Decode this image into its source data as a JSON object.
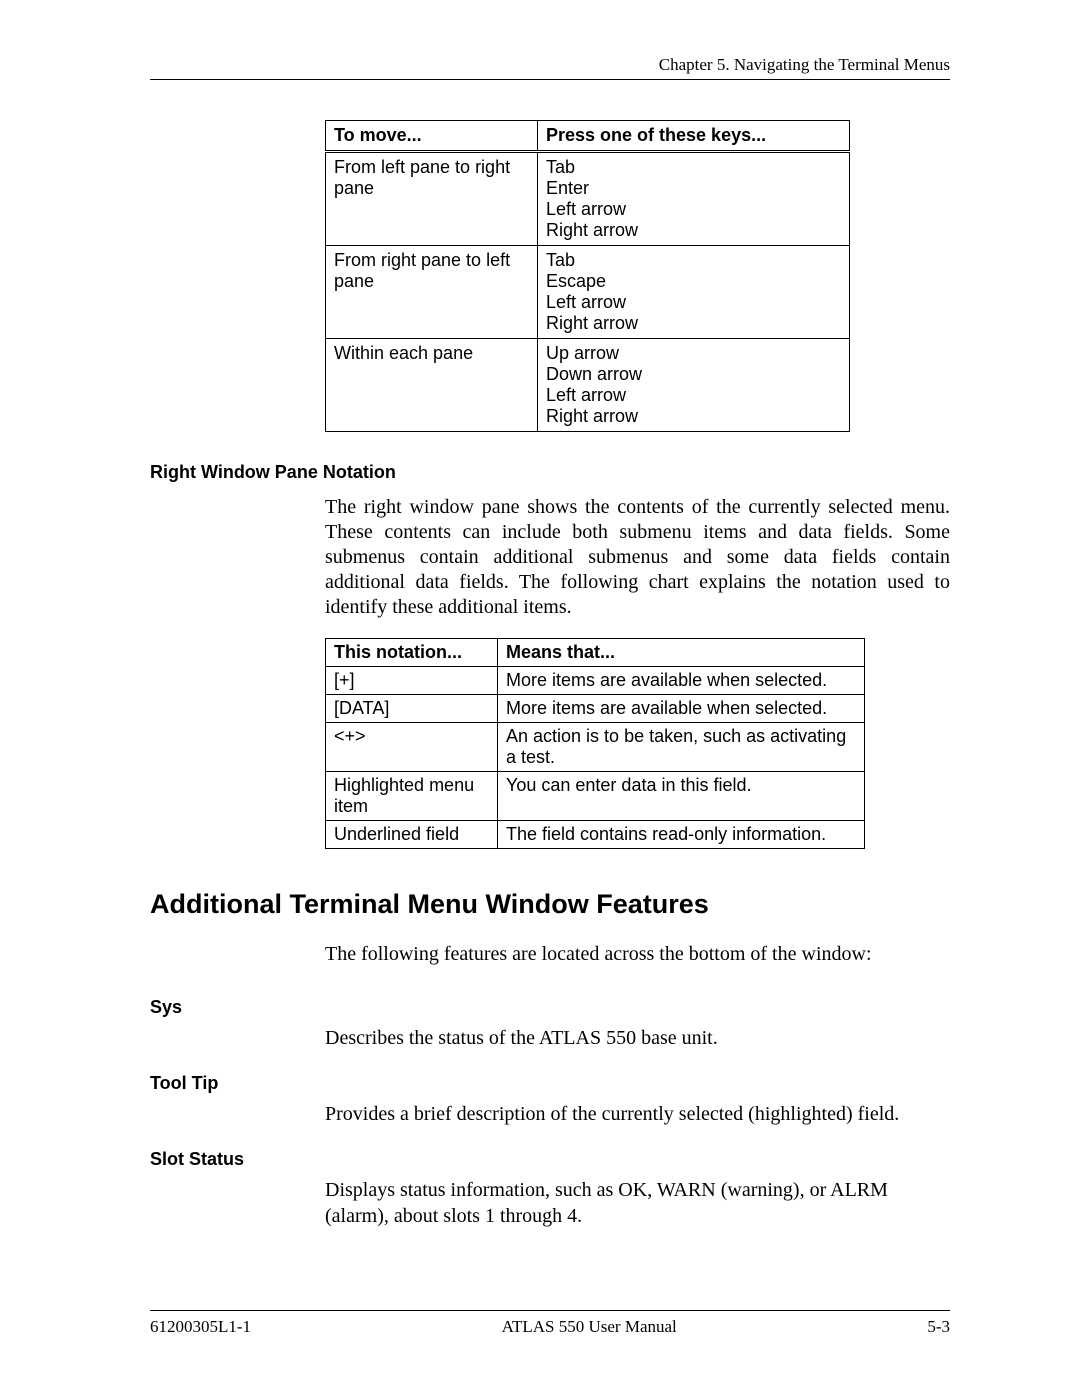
{
  "header": {
    "chapter": "Chapter 5.  Navigating the Terminal Menus"
  },
  "table1": {
    "headers": [
      "To move...",
      "Press one of these keys..."
    ],
    "rows": [
      {
        "c1": "From left pane to right pane",
        "c2": "Tab\nEnter\nLeft arrow\nRight arrow"
      },
      {
        "c1": "From right pane to left pane",
        "c2": "Tab\nEscape\nLeft arrow\nRight arrow"
      },
      {
        "c1": "Within each pane",
        "c2": "Up arrow\nDown arrow\nLeft arrow\nRight arrow"
      }
    ]
  },
  "section1": {
    "title": "Right Window Pane Notation",
    "text": "The right window pane shows the contents of the currently selected menu. These contents can include both submenu items and data fields. Some submenus contain additional submenus and some data fields contain additional data fields. The following chart explains the notation used to identify these additional items."
  },
  "table2": {
    "headers": [
      "This notation...",
      "Means that..."
    ],
    "rows": [
      {
        "c1": "[+]",
        "c2": "More items are available when selected."
      },
      {
        "c1": "[DATA]",
        "c2": "More items are available when selected."
      },
      {
        "c1": "<+>",
        "c2": "An action is to be taken, such as activating a test."
      },
      {
        "c1": "Highlighted menu item",
        "c2": "You can enter data in this field."
      },
      {
        "c1": "Underlined field",
        "c2": "The field contains read-only information."
      }
    ]
  },
  "section2": {
    "title": "Additional Terminal Menu Window Features",
    "intro": "The following features are located across the bottom of the window:"
  },
  "features": [
    {
      "label": "Sys",
      "text": "Describes the status of the ATLAS 550 base unit."
    },
    {
      "label": "Tool Tip",
      "text": "Provides a brief description of the currently selected (highlighted) field."
    },
    {
      "label": "Slot Status",
      "text": "Displays status information, such as OK, WARN (warning), or ALRM (alarm), about slots 1 through 4."
    }
  ],
  "footer": {
    "left": "61200305L1-1",
    "center": "ATLAS 550 User Manual",
    "right": "5-3"
  }
}
